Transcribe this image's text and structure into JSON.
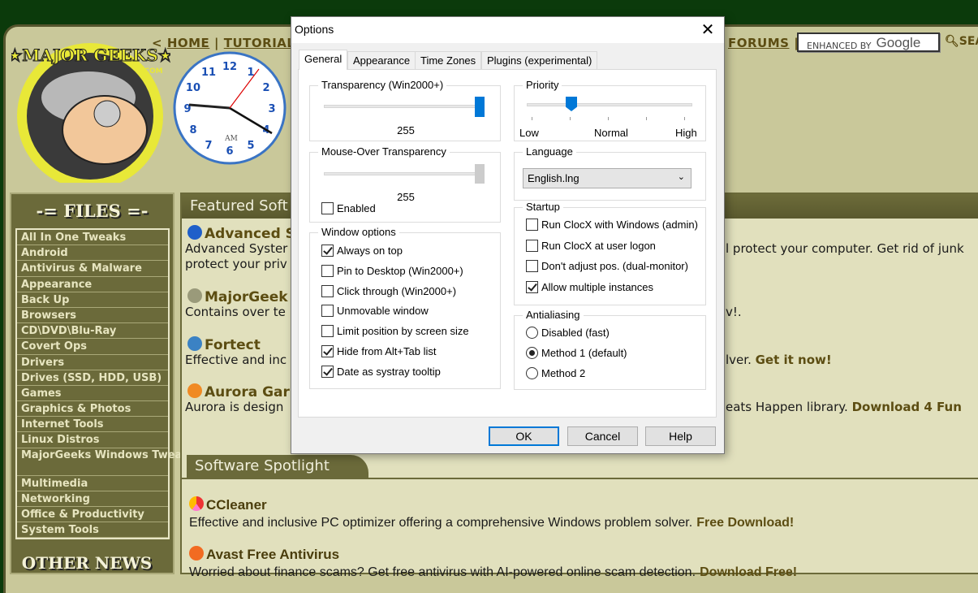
{
  "site": {
    "logo_text": "MAJOR GEEKS .COM",
    "nav": {
      "prefix": "<",
      "home": "HOME",
      "sep": "|",
      "tutorials": "TUTORIALS",
      "forums": "FORUMS",
      "search_placeholder": "ENHANCED BY",
      "search_brand": "Google",
      "search_button": "SEA"
    },
    "clock": {
      "numbers": [
        "12",
        "1",
        "2",
        "3",
        "4",
        "5",
        "6",
        "7",
        "8",
        "9",
        "10",
        "11"
      ],
      "ampm": "AM"
    },
    "files_header": "-= FILES =-",
    "files": [
      "All In One Tweaks",
      "Android",
      "Antivirus & Malware",
      "Appearance",
      "Back Up",
      "Browsers",
      "CD\\DVD\\Blu-Ray",
      "Covert Ops",
      "Drivers",
      "Drives (SSD, HDD, USB)",
      "Games",
      "Graphics & Photos",
      "Internet Tools",
      "Linux Distros",
      "MajorGeeks Windows Tweaks",
      "Multimedia",
      "Networking",
      "Office & Productivity",
      "System Tools"
    ],
    "other_news": "OTHER NEWS",
    "featured_header": "Featured Soft",
    "featured": [
      {
        "title": "Advanced S",
        "desc_left": "Advanced Syster",
        "desc_right": "l protect your computer. Get rid of junk",
        "desc2_left": "protect your priv"
      },
      {
        "title": "MajorGeek",
        "desc_left": "Contains over te",
        "desc_right": "v!."
      },
      {
        "title": "Fortect",
        "desc_left": "Effective and inc",
        "desc_right": "lver.",
        "link": "Get it now!"
      },
      {
        "title": "Aurora Gar",
        "desc_left": "Aurora is design",
        "desc_right": "eats Happen library.",
        "link": "Download 4 Fun"
      }
    ],
    "spotlight_header": "Software Spotlight",
    "spotlight": [
      {
        "title": "CCleaner",
        "desc": "Effective and inclusive PC optimizer offering a comprehensive Windows problem solver.",
        "link": "Free Download!"
      },
      {
        "title": "Avast Free Antivirus",
        "desc": "Worried about finance scams? Get free antivirus with AI-powered online scam detection.",
        "link": "Download Free!"
      }
    ]
  },
  "dialog": {
    "title": "Options",
    "tabs": [
      "General",
      "Appearance",
      "Time Zones",
      "Plugins (experimental)"
    ],
    "active_tab": "General",
    "transparency": {
      "label": "Transparency (Win2000+)",
      "value": "255",
      "slider_fraction": 1.0
    },
    "mouse_over": {
      "label": "Mouse-Over Transparency",
      "value": "255",
      "slider_fraction": 1.0,
      "enabled_label": "Enabled",
      "enabled": false
    },
    "window_options": {
      "label": "Window options",
      "items": [
        {
          "label": "Always on top",
          "checked": true
        },
        {
          "label": "Pin to Desktop (Win2000+)",
          "checked": false
        },
        {
          "label": "Click through (Win2000+)",
          "checked": false
        },
        {
          "label": "Unmovable window",
          "checked": false
        },
        {
          "label": "Limit position by screen size",
          "checked": false
        },
        {
          "label": "Hide from Alt+Tab list",
          "checked": true
        },
        {
          "label": "Date as systray tooltip",
          "checked": true
        }
      ]
    },
    "priority": {
      "label": "Priority",
      "low": "Low",
      "normal": "Normal",
      "high": "High",
      "position": 1,
      "ticks": 5
    },
    "language": {
      "label": "Language",
      "value": "English.lng"
    },
    "startup": {
      "label": "Startup",
      "items": [
        {
          "label": "Run ClocX with Windows (admin)",
          "checked": false
        },
        {
          "label": "Run ClocX at user logon",
          "checked": false
        },
        {
          "label": "Don't adjust pos. (dual-monitor)",
          "checked": false
        },
        {
          "label": "Allow multiple instances",
          "checked": true
        }
      ]
    },
    "antialiasing": {
      "label": "Antialiasing",
      "items": [
        {
          "label": "Disabled (fast)",
          "selected": false
        },
        {
          "label": "Method 1 (default)",
          "selected": true
        },
        {
          "label": "Method 2",
          "selected": false
        }
      ]
    },
    "buttons": {
      "ok": "OK",
      "cancel": "Cancel",
      "help": "Help"
    }
  }
}
